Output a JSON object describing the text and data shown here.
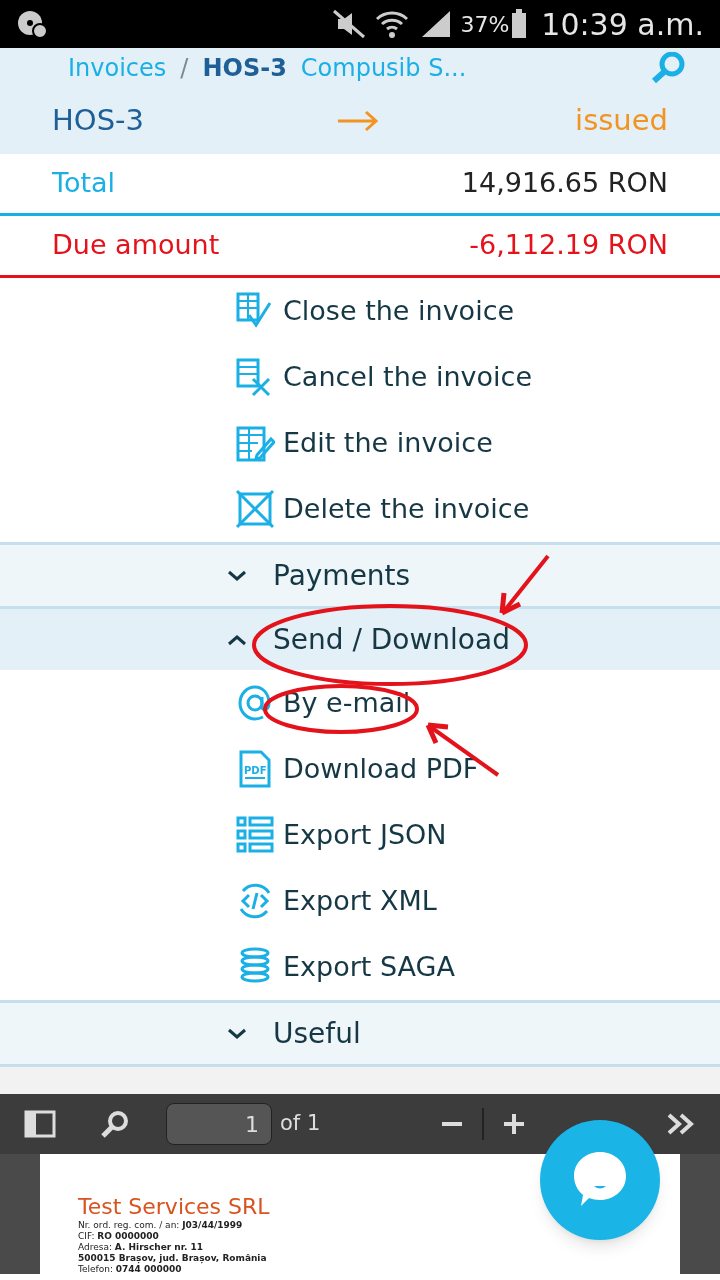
{
  "status_bar": {
    "battery": "37%",
    "time": "10:39 a.m."
  },
  "breadcrumb": [
    {
      "text": "Invoices",
      "kind": "link"
    },
    {
      "text": "/",
      "kind": "separator"
    },
    {
      "text": "HOS-3",
      "kind": "current"
    },
    {
      "text": "Compusib S...",
      "kind": "link"
    }
  ],
  "invoice": {
    "number": "HOS-3",
    "status": "issued"
  },
  "summary": [
    {
      "label": "Total",
      "value": "14,916.65 RON",
      "kind": "total"
    },
    {
      "label": "Due amount",
      "value": "-6,112.19 RON",
      "kind": "due"
    }
  ],
  "actions": [
    {
      "label": "Close the invoice"
    },
    {
      "label": "Cancel the invoice"
    },
    {
      "label": "Edit the invoice"
    },
    {
      "label": "Delete the invoice"
    }
  ],
  "sections": [
    {
      "title": "Payments",
      "expanded": false
    },
    {
      "title": "Send / Download",
      "expanded": true,
      "items": [
        {
          "label": "By e-mail"
        },
        {
          "label": "Download PDF",
          "icon_text": "PDF"
        },
        {
          "label": "Export JSON"
        },
        {
          "label": "Export XML"
        },
        {
          "label": "Export SAGA"
        }
      ]
    },
    {
      "title": "Useful",
      "expanded": false
    }
  ],
  "pdf_viewer": {
    "page": "1",
    "page_count": "of 1",
    "document": {
      "company": "Test Services SRL",
      "lines": [
        "Nr. ord. reg. com. / an: **J03/44/1999**",
        "CIF: **RO 0000000**",
        "Adresa: **A. Hirscher nr. 11**",
        "**500015 Brașov, jud. Brașov, România**",
        "Telefon: **0744 000000**"
      ]
    }
  }
}
